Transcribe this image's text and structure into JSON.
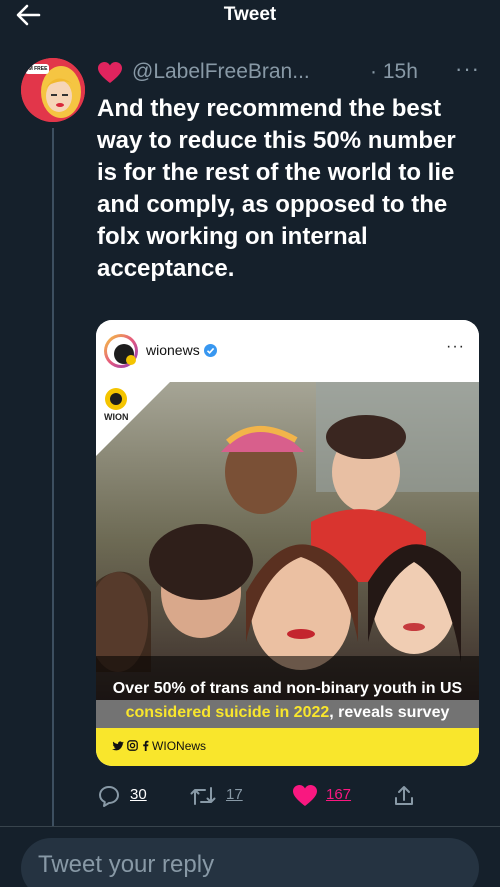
{
  "header": {
    "title": "Tweet",
    "back_icon": "back-arrow-icon"
  },
  "tweet": {
    "author_handle": "@LabelFreeBran...",
    "author_emoji": "heart-emoji",
    "avatar_badge": "I'M FREE",
    "time_separator": "·",
    "time": "15h",
    "more_label": "···",
    "text": "And they recommend the best way to reduce this 50% number is for the rest of the world to lie and comply, as opposed to the folx working on internal acceptance."
  },
  "embedded_post": {
    "account": "wionews",
    "verified": true,
    "more_label": "···",
    "logo_text": "WION",
    "caption_line1": "Over 50% of trans and non-binary youth in US",
    "caption_highlight": "considered suicide in 2022",
    "caption_rest": ", reveals survey",
    "footer_label": "WIONews",
    "footer_icons": [
      "twitter-icon",
      "instagram-icon",
      "facebook-icon"
    ],
    "colors": {
      "highlight": "#f9e62c"
    }
  },
  "actions": {
    "replies": "30",
    "retweets": "17",
    "likes": "167",
    "like_color": "#f91880"
  },
  "reply_box": {
    "placeholder": "Tweet your reply"
  },
  "colors": {
    "background": "#15202b",
    "secondary_text": "#8899a6"
  }
}
